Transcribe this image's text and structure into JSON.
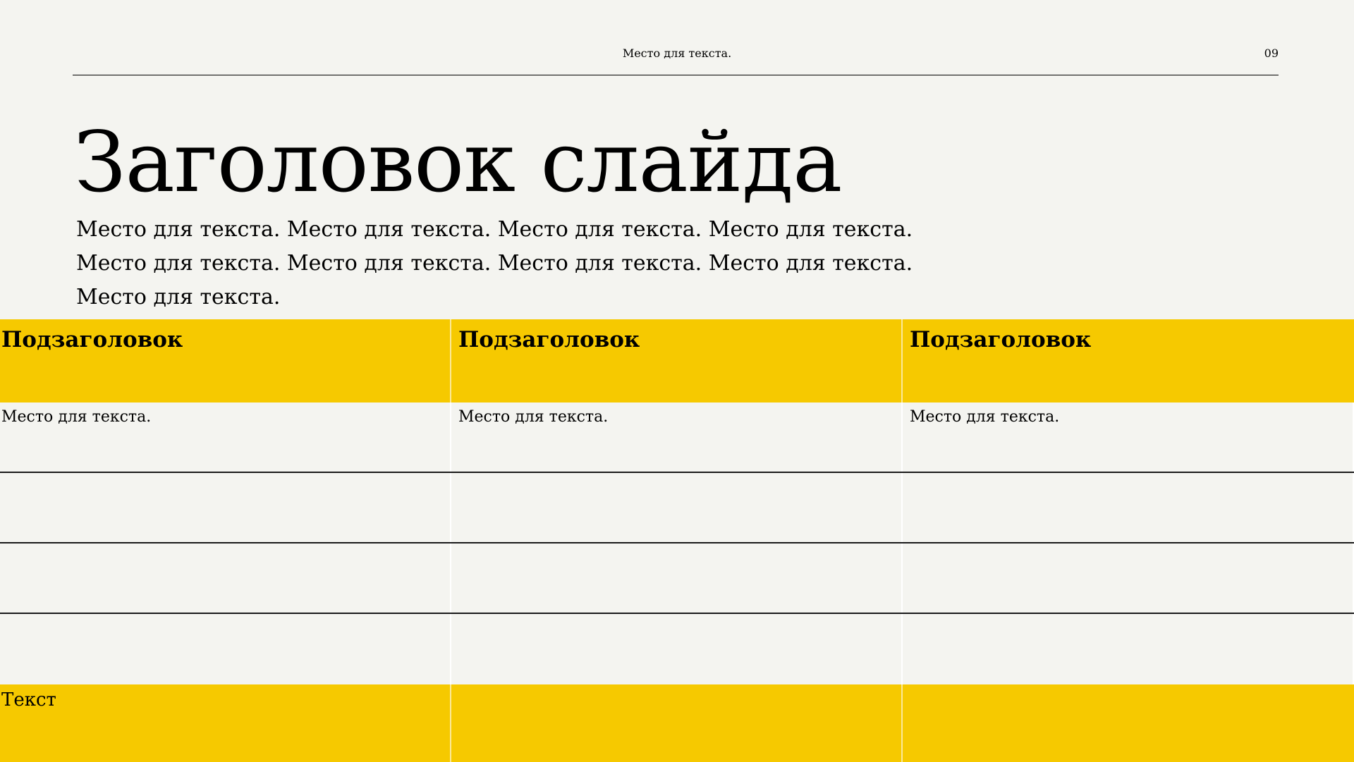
{
  "header": {
    "text": "Место для текста.",
    "page_number": "09"
  },
  "slide": {
    "title": "Заголовок слайда",
    "body": "Место для текста. Место для текста. Место для текста. Место для текста. Место для текста. Место для текста. Место для текста. Место для текста. Место для текста."
  },
  "table": {
    "header_row": [
      "Подзаголовок",
      "Подзаголовок",
      "Подзаголовок"
    ],
    "rows": [
      [
        "Место для текста.",
        "Место для текста.",
        "Место для текста."
      ],
      [
        "",
        "",
        ""
      ],
      [
        "",
        "",
        ""
      ],
      [
        "",
        "",
        ""
      ]
    ],
    "footer_row": [
      "Текст",
      "",
      ""
    ]
  },
  "colors": {
    "background": "#f4f4f0",
    "accent": "#f6c900",
    "text": "#000000"
  }
}
